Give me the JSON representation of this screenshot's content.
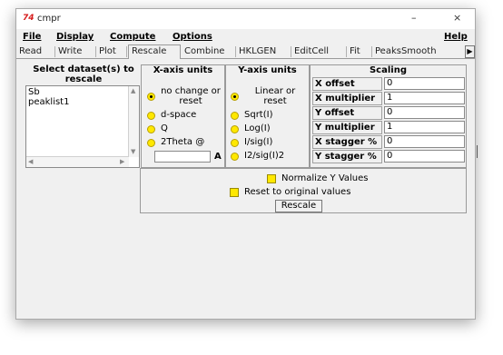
{
  "window": {
    "title": "cmpr",
    "icon_text": "74",
    "minimize": "–",
    "close": "×"
  },
  "menu": {
    "file": "File",
    "display": "Display",
    "compute": "Compute",
    "options": "Options",
    "help": "Help"
  },
  "tabs": [
    "Read",
    "Write",
    "Plot",
    "Rescale",
    "Combine",
    "HKLGEN",
    "EditCell",
    "Fit",
    "PeaksSmooth"
  ],
  "active_tab": "Rescale",
  "dataset": {
    "heading": "Select dataset(s) to rescale",
    "items": [
      "Sb",
      "peaklist1"
    ]
  },
  "xaxis": {
    "heading": "X-axis units",
    "options": [
      "no change or reset",
      "d-space",
      "Q",
      "2Theta @"
    ],
    "selected": "no change or reset",
    "wavelength_unit": "A",
    "wavelength_value": ""
  },
  "yaxis": {
    "heading": "Y-axis units",
    "options": [
      "Linear or reset",
      "Sqrt(I)",
      "Log(I)",
      "I/sig(I)",
      "I2/sig(I)2"
    ],
    "selected": "Linear or reset"
  },
  "scaling": {
    "heading": "Scaling",
    "rows": [
      {
        "label": "X offset",
        "value": "0"
      },
      {
        "label": "X multiplier",
        "value": "1"
      },
      {
        "label": "Y offset",
        "value": "0"
      },
      {
        "label": "Y multiplier",
        "value": "1"
      },
      {
        "label": "X stagger %",
        "value": "0"
      },
      {
        "label": "Y stagger %",
        "value": "0"
      }
    ]
  },
  "options": {
    "normalize": "Normalize Y Values",
    "reset": "Reset to original values"
  },
  "rescale_button": "Rescale",
  "colors": {
    "radio": "#ffe800",
    "window_bg": "#f0f0f0",
    "icon": "#d61a1a"
  }
}
